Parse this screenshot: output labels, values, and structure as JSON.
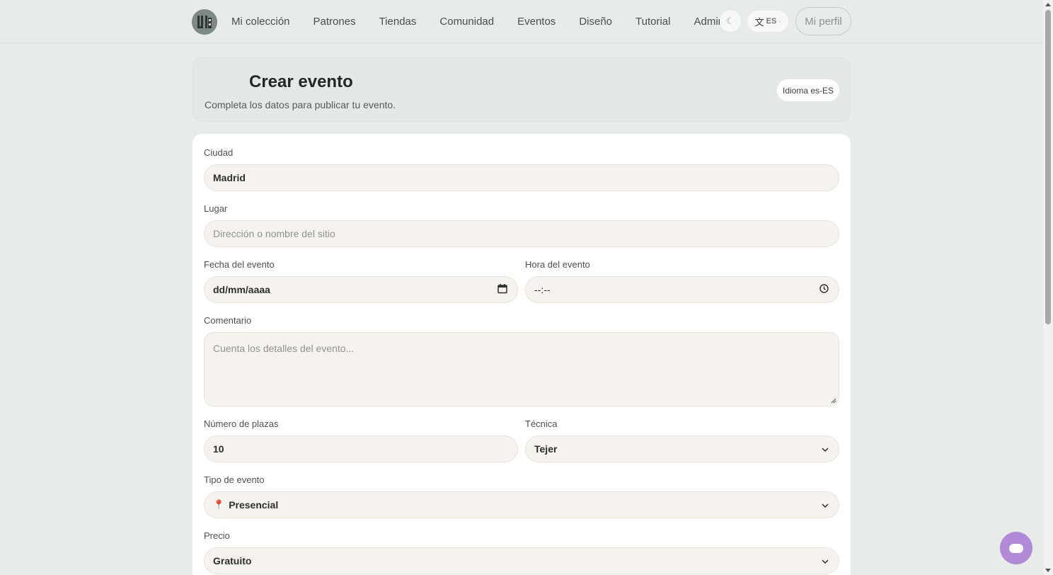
{
  "nav": {
    "logo_icon": "yarn-logo-icon",
    "items": [
      {
        "label": "Mi colección"
      },
      {
        "label": "Patrones"
      },
      {
        "label": "Tiendas"
      },
      {
        "label": "Comunidad"
      },
      {
        "label": "Eventos"
      },
      {
        "label": "Diseño"
      },
      {
        "label": "Tutorial"
      },
      {
        "label": "Admin"
      }
    ],
    "theme_icon": "☾",
    "lang_glyph": "文",
    "lang_code": "ES",
    "lang_caret": "·",
    "profile_label": "Mi perfil"
  },
  "header": {
    "title": "Crear evento",
    "subtitle": "Completa los datos para publicar tu evento.",
    "locale_badge": "Idioma es-ES"
  },
  "form": {
    "city": {
      "label": "Ciudad",
      "value": "Madrid"
    },
    "place": {
      "label": "Lugar",
      "placeholder": "Dirección o nombre del sitio"
    },
    "date": {
      "label": "Fecha del evento",
      "value": "dd/mm/aaaa",
      "icon": "calendar-icon"
    },
    "time": {
      "label": "Hora del evento",
      "value": "--:--",
      "icon": "clock-icon"
    },
    "comment": {
      "label": "Comentario",
      "placeholder": "Cuenta los detalles del evento..."
    },
    "seats": {
      "label": "Número de plazas",
      "value": "10"
    },
    "technique": {
      "label": "Técnica",
      "value": "Tejer"
    },
    "event_type": {
      "label": "Tipo de evento",
      "icon": "📍",
      "value": "Presencial"
    },
    "price": {
      "label": "Precio",
      "value": "Gratuito"
    }
  },
  "colors": {
    "background": "#e7ece9",
    "field_bg": "#f6f3ee",
    "chat_fab": "#b08ad6"
  }
}
